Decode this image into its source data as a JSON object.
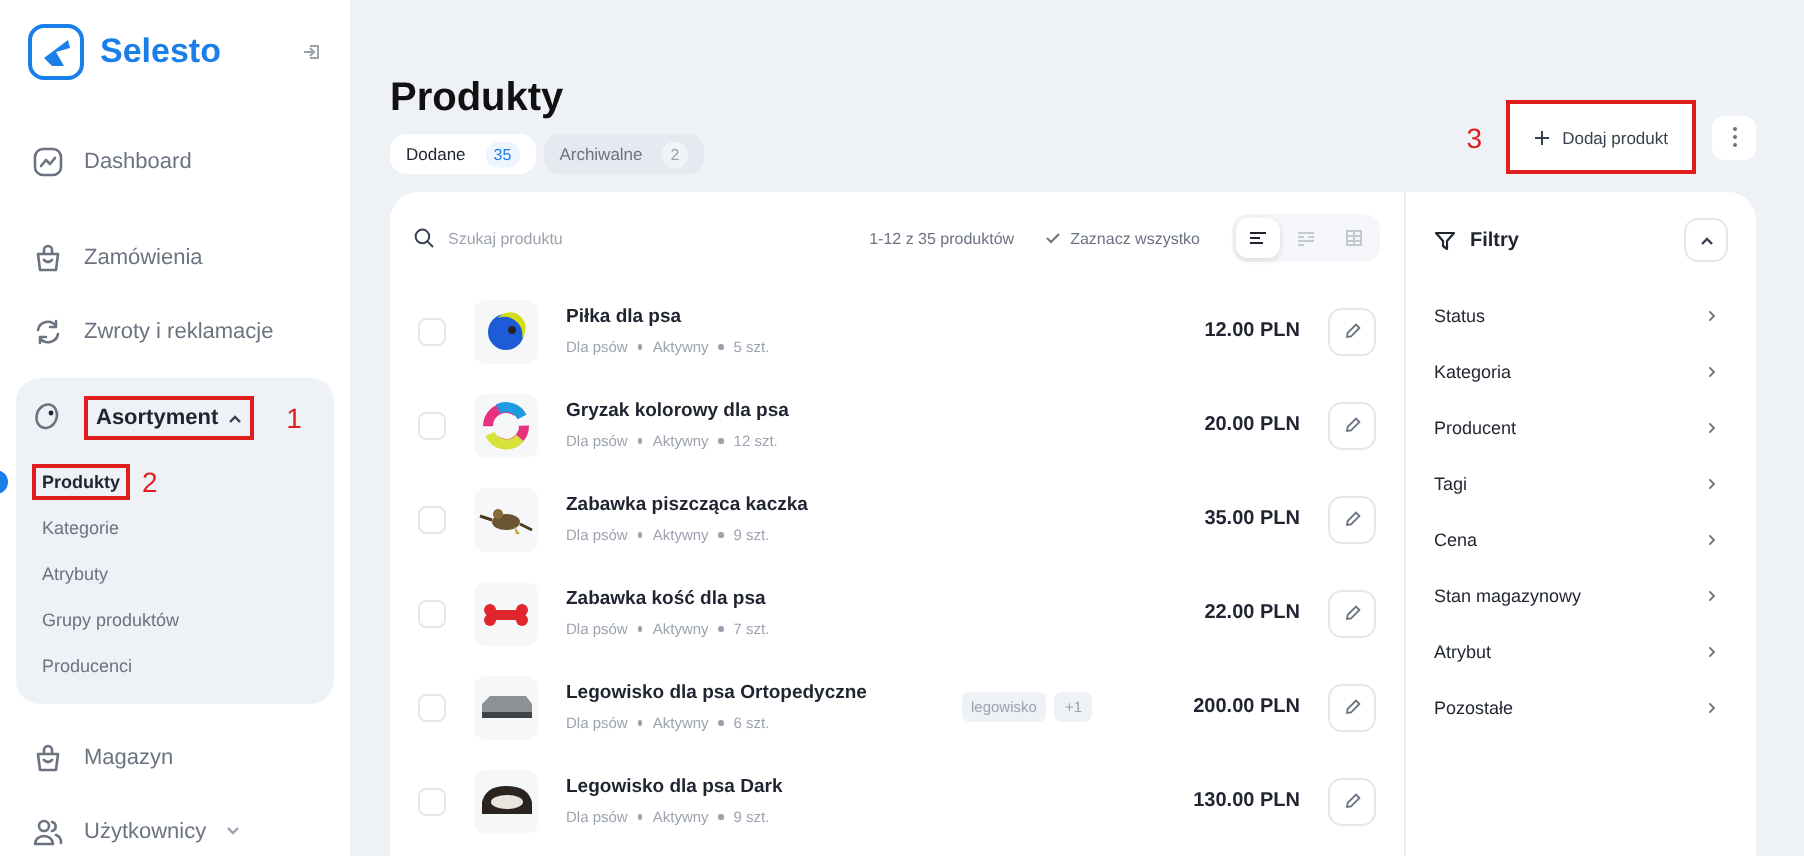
{
  "brand": {
    "name": "Selesto"
  },
  "nav": [
    {
      "label": "Dashboard",
      "kind": "chart",
      "selected": false
    },
    {
      "label": "Zamówienia",
      "kind": "bag",
      "selected": false
    },
    {
      "label": "Zwroty i reklamacje",
      "kind": "return",
      "selected": false
    },
    {
      "label": "Asortyment",
      "kind": "tag",
      "selected": false,
      "expanded": true,
      "callout": "1",
      "children": [
        {
          "label": "Produkty",
          "selected": true,
          "callout": "2"
        },
        {
          "label": "Kategorie",
          "selected": false
        },
        {
          "label": "Atrybuty",
          "selected": false
        },
        {
          "label": "Grupy produktów",
          "selected": false
        },
        {
          "label": "Producenci",
          "selected": false
        }
      ]
    },
    {
      "label": "Magazyn",
      "kind": "bag",
      "selected": false
    },
    {
      "label": "Użytkownicy",
      "kind": "users",
      "selected": false,
      "expanded": false
    }
  ],
  "page": {
    "title": "Produkty",
    "tabs": [
      {
        "label": "Dodane",
        "count": "35",
        "selected": true
      },
      {
        "label": "Archiwalne",
        "count": "2",
        "selected": false
      }
    ],
    "add_button": {
      "label": "Dodaj produkt",
      "callout": "3"
    }
  },
  "toolbar": {
    "search": {
      "placeholder": "Szukaj produktu"
    },
    "range": "1-12 z 35 produktów",
    "select_all": "Zaznacz wszystko",
    "views": [
      {
        "kind": "list",
        "selected": true
      },
      {
        "kind": "compact",
        "selected": false
      },
      {
        "kind": "grid",
        "selected": false
      }
    ]
  },
  "products": [
    {
      "name": "Piłka dla psa",
      "category": "Dla psów",
      "status": "Aktywny",
      "stock": "5 szt.",
      "price": "12.00 PLN",
      "checked": false,
      "kind": "ball"
    },
    {
      "name": "Gryzak kolorowy dla psa",
      "category": "Dla psów",
      "status": "Aktywny",
      "stock": "12 szt.",
      "price": "20.00 PLN",
      "checked": false,
      "kind": "ring"
    },
    {
      "name": "Zabawka piszcząca kaczka",
      "category": "Dla psów",
      "status": "Aktywny",
      "stock": "9 szt.",
      "price": "35.00 PLN",
      "checked": false,
      "kind": "duck"
    },
    {
      "name": "Zabawka kość dla psa",
      "category": "Dla psów",
      "status": "Aktywny",
      "stock": "7 szt.",
      "price": "22.00 PLN",
      "checked": false,
      "kind": "bone"
    },
    {
      "name": "Legowisko dla psa Ortopedyczne",
      "category": "Dla psów",
      "status": "Aktywny",
      "stock": "6 szt.",
      "price": "200.00 PLN",
      "checked": false,
      "kind": "bed",
      "tags": [
        "legowisko",
        "+1"
      ]
    },
    {
      "name": "Legowisko dla psa Dark",
      "category": "Dla psów",
      "status": "Aktywny",
      "stock": "9 szt.",
      "price": "130.00 PLN",
      "checked": false,
      "kind": "bed_dark"
    }
  ],
  "filters": {
    "title": "Filtry",
    "expanded": true,
    "items": [
      "Status",
      "Kategoria",
      "Producent",
      "Tagi",
      "Cena",
      "Stan magazynowy",
      "Atrybut",
      "Pozostałe"
    ]
  }
}
